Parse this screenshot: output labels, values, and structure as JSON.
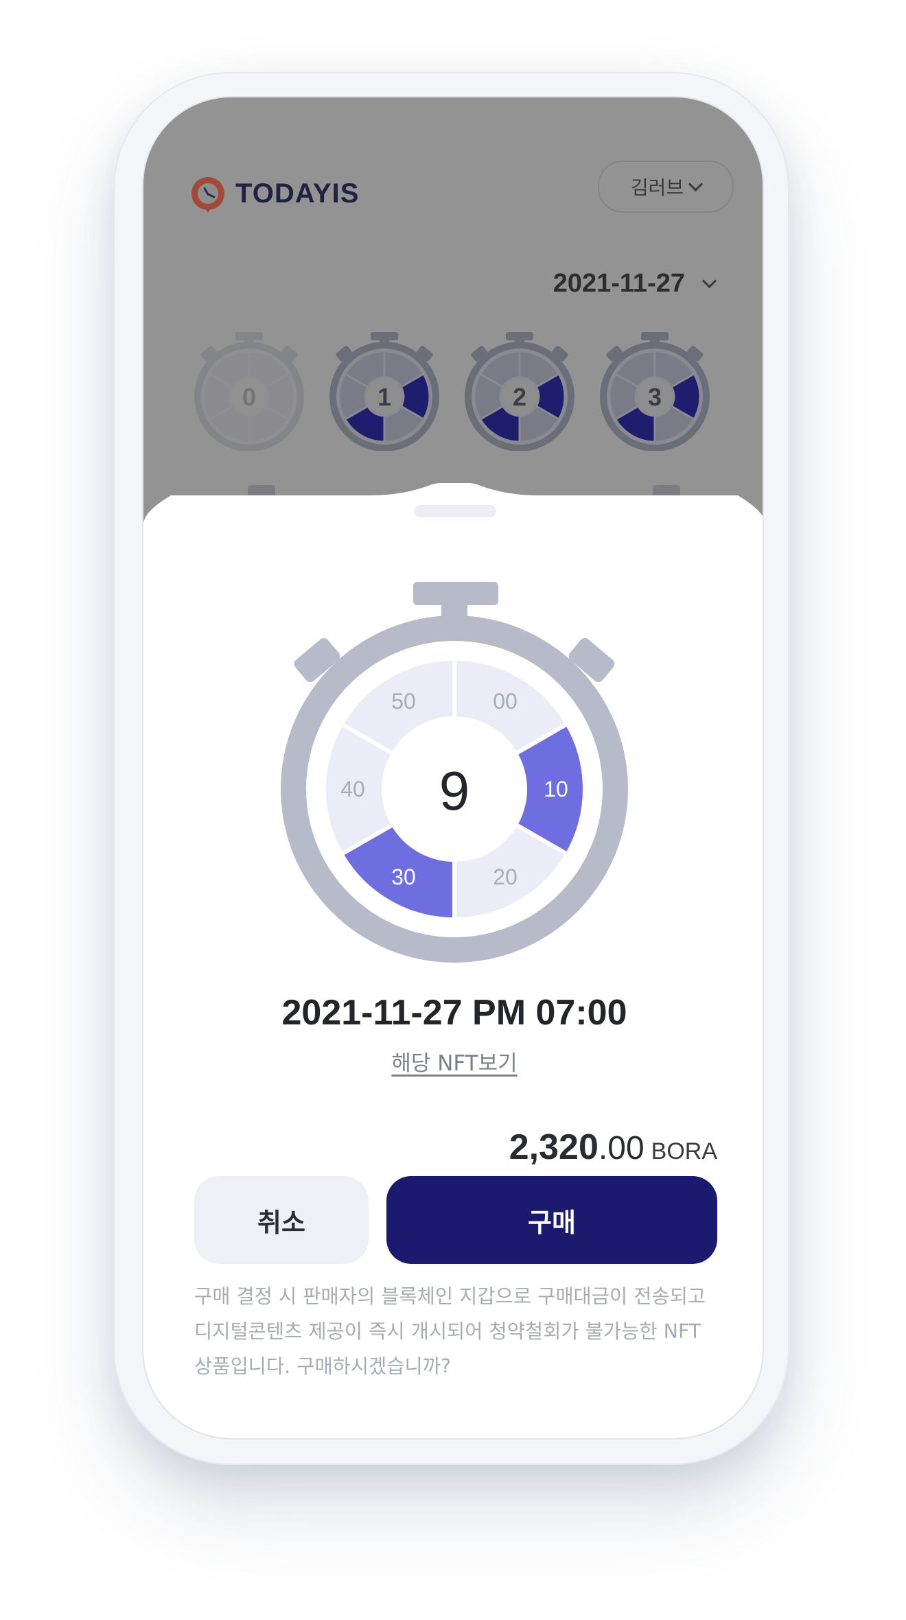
{
  "app": {
    "brand": "TODAYIS",
    "user_name": "김러브",
    "selected_date": "2021-11-27"
  },
  "background_grid": {
    "watches": [
      {
        "number": "0",
        "faded": true
      },
      {
        "number": "1",
        "faded": false
      },
      {
        "number": "2",
        "faded": false
      },
      {
        "number": "3",
        "faded": false
      }
    ]
  },
  "sheet": {
    "hour": "9",
    "segments": [
      {
        "label": "00",
        "selected": false
      },
      {
        "label": "10",
        "selected": true
      },
      {
        "label": "20",
        "selected": false
      },
      {
        "label": "30",
        "selected": true
      },
      {
        "label": "40",
        "selected": false
      },
      {
        "label": "50",
        "selected": false
      }
    ],
    "datetime": "2021-11-27 PM 07:00",
    "nft_link": "해당 NFT보기",
    "price_int": "2,320",
    "price_dec": ".00",
    "price_unit": "BORA",
    "cancel_label": "취소",
    "buy_label": "구매",
    "notice": "구매 결정 시 판매자의 블록체인 지갑으로 구매대금이 전송되고 디지털콘텐츠 제공이 즉시 개시되어 청약철회가 불가능한 NFT 상품입니다. 구매하시겠습니까?"
  },
  "colors": {
    "selected_segment": "#6f6ee0",
    "unselected_segment": "#ecebf8",
    "watch_frame": "#b6bac9",
    "buy_button": "#1c1a6e",
    "cancel_button": "#eef0f5"
  }
}
